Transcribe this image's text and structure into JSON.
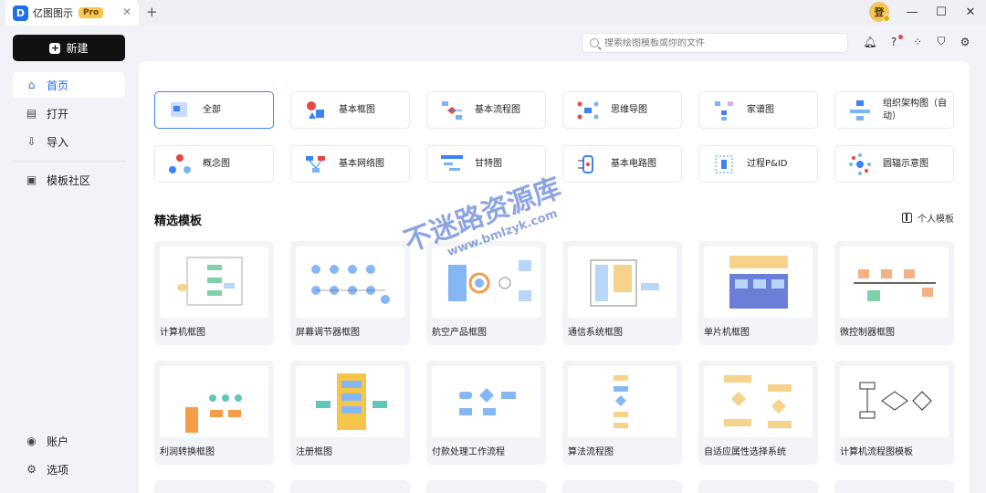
{
  "titlebar": {
    "app_name": "亿图图示",
    "badge": "Pro",
    "user_initial": "登"
  },
  "sidebar": {
    "new_label": "新建",
    "items": [
      {
        "label": "首页"
      },
      {
        "label": "打开"
      },
      {
        "label": "导入"
      },
      {
        "label": "模板社区"
      }
    ],
    "bottom": [
      {
        "label": "账户"
      },
      {
        "label": "选项"
      }
    ]
  },
  "search": {
    "placeholder": "搜索绘图模板或你的文件"
  },
  "categories": [
    {
      "label": "全部"
    },
    {
      "label": "基本框图"
    },
    {
      "label": "基本流程图"
    },
    {
      "label": "思维导图"
    },
    {
      "label": "家谱图"
    },
    {
      "label": "组织架构图（自动）"
    },
    {
      "label": "概念图"
    },
    {
      "label": "基本网络图"
    },
    {
      "label": "甘特图"
    },
    {
      "label": "基本电路图"
    },
    {
      "label": "过程P&ID"
    },
    {
      "label": "圆辐示意图"
    }
  ],
  "featured": {
    "title": "精选模板",
    "personal_label": "个人模板",
    "cards": [
      {
        "label": "计算机框图"
      },
      {
        "label": "屏幕调节器框图"
      },
      {
        "label": "航空产品框图"
      },
      {
        "label": "通信系统框图"
      },
      {
        "label": "单片机框图"
      },
      {
        "label": "微控制器框图"
      },
      {
        "label": "利润转换框图"
      },
      {
        "label": "注册框图"
      },
      {
        "label": "付款处理工作流程"
      },
      {
        "label": "算法流程图"
      },
      {
        "label": "自适应属性选择系统"
      },
      {
        "label": "计算机流程图模板"
      }
    ]
  },
  "watermark": {
    "line1": "不迷路资源库",
    "line2": "www.bmlzyk.com"
  }
}
